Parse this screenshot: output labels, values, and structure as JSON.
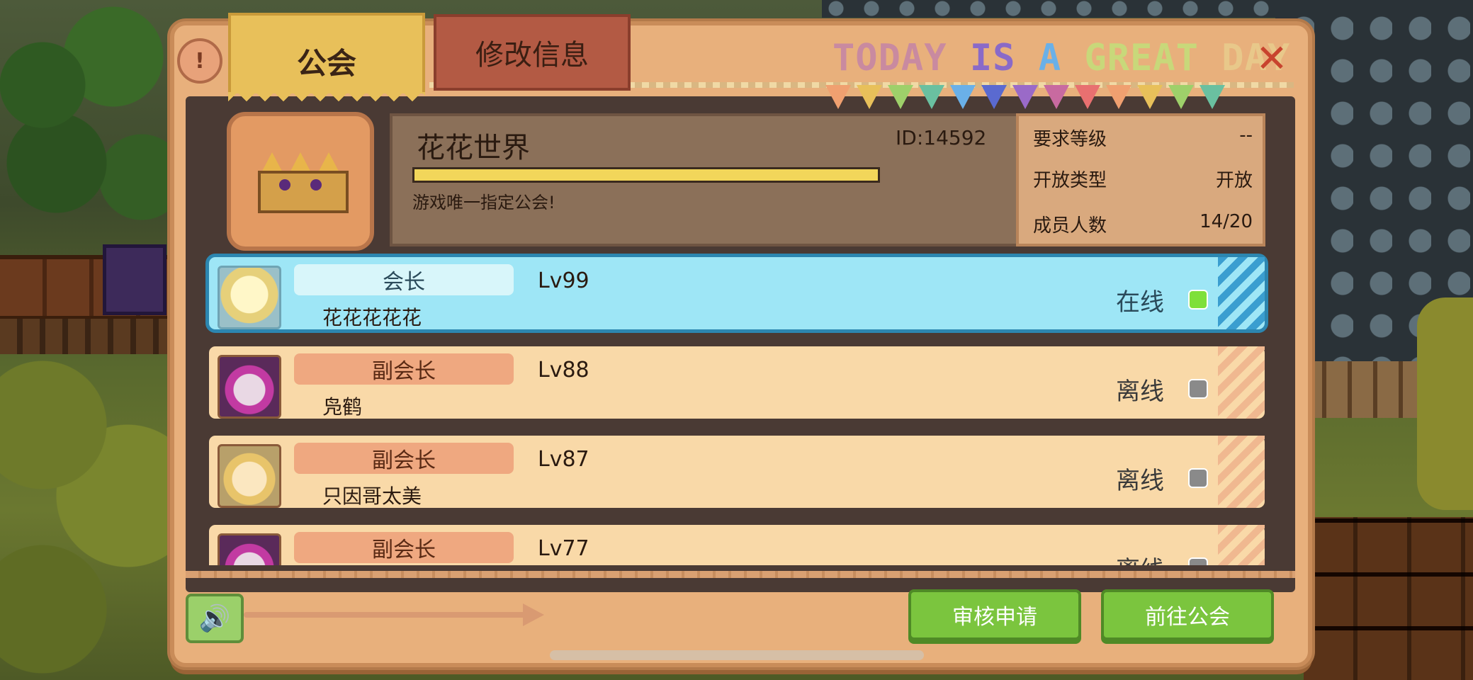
{
  "tabs": {
    "guild": "公会",
    "edit_info": "修改信息"
  },
  "motto": {
    "words": [
      {
        "text": "TODAY",
        "color": "#c98aa0"
      },
      {
        "text": " ",
        "color": "#000000"
      },
      {
        "text": "IS",
        "color": "#8a6ac8"
      },
      {
        "text": " ",
        "color": "#000000"
      },
      {
        "text": "A",
        "color": "#6ab0e8"
      },
      {
        "text": " ",
        "color": "#000000"
      },
      {
        "text": "GREAT",
        "color": "#c8d87a"
      },
      {
        "text": " ",
        "color": "#000000"
      },
      {
        "text": "DAY",
        "color": "#e8c88a"
      }
    ]
  },
  "close_icon": "✕",
  "help_icon": "!",
  "bunting_colors": [
    "#f0a070",
    "#e8c05a",
    "#9ed06a",
    "#6ac0a0",
    "#6ab0e8",
    "#5a6ad0",
    "#9a6ac8",
    "#c86aa0",
    "#e87070",
    "#f0a070",
    "#e8c05a",
    "#9ed06a",
    "#6ac0a0"
  ],
  "guild": {
    "name": "花花世界",
    "id_label": "ID:14592",
    "exp_progress": 1.0,
    "description": "游戏唯一指定公会!",
    "stats": [
      {
        "label": "要求等级",
        "value": "--"
      },
      {
        "label": "开放类型",
        "value": "开放"
      },
      {
        "label": "成员人数",
        "value": "14/20"
      }
    ]
  },
  "members": [
    {
      "role": "会长",
      "name": "花花花花花",
      "level": "Lv99",
      "status": "在线",
      "online": true,
      "avatar": "a1"
    },
    {
      "role": "副会长",
      "name": "凫鹤",
      "level": "Lv88",
      "status": "离线",
      "online": false,
      "avatar": "a2"
    },
    {
      "role": "副会长",
      "name": "只因哥太美",
      "level": "Lv87",
      "status": "离线",
      "online": false,
      "avatar": "a3"
    },
    {
      "role": "副会长",
      "name": "",
      "level": "Lv77",
      "status": "离线",
      "online": false,
      "avatar": "a2"
    }
  ],
  "bottom": {
    "sound_icon": "🔊",
    "review_button": "审核申请",
    "goto_button": "前往公会"
  }
}
